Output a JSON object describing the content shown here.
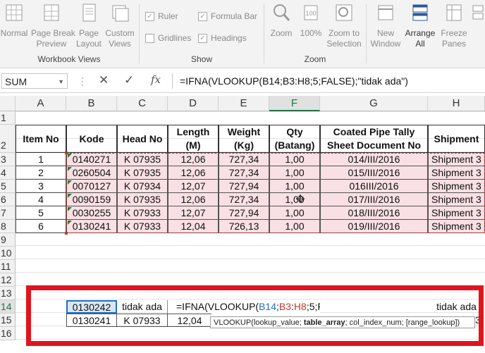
{
  "ribbon": {
    "workbook_views": {
      "label": "Workbook Views",
      "buttons": [
        {
          "label": "Normal",
          "icon": "normal-view-icon"
        },
        {
          "label": "Page Break\nPreview",
          "icon": "page-break-icon"
        },
        {
          "label": "Page\nLayout",
          "icon": "page-layout-icon"
        },
        {
          "label": "Custom\nViews",
          "icon": "custom-views-icon"
        }
      ]
    },
    "show": {
      "label": "Show",
      "ruler": "Ruler",
      "formula_bar": "Formula Bar",
      "gridlines": "Gridlines",
      "headings": "Headings"
    },
    "zoom": {
      "label": "Zoom",
      "zoom_btn": "Zoom",
      "hundred_btn": "100%",
      "selection_btn": "Zoom to\nSelection"
    },
    "window": {
      "new_window": "New\nWindow",
      "arrange_all": "Arrange\nAll",
      "freeze_panes": "Freeze\nPanes"
    }
  },
  "formula_bar": {
    "name_box": "SUM",
    "formula": "=IFNA(VLOOKUP(B14;B3:H8;5;FALSE);\"tidak ada\")",
    "cancel": "✕",
    "enter": "✓",
    "fx": "fx"
  },
  "columns": [
    "A",
    "B",
    "C",
    "D",
    "E",
    "F",
    "G",
    "H"
  ],
  "rows": [
    "1",
    "2",
    "3",
    "4",
    "5",
    "6",
    "7",
    "8",
    "9",
    "10",
    "11",
    "12",
    "13",
    "14",
    "15",
    "16"
  ],
  "headers": {
    "item_no": "Item No",
    "kode": "Kode",
    "head_no": "Head No",
    "length": "Length\n(M)",
    "weight": "Weight\n(Kg)",
    "qty": "Qty\n(Batang)",
    "tally": "Coated Pipe Tally\nSheet Document No",
    "shipment": "Shipment"
  },
  "table": [
    [
      "1",
      "0140271",
      "K 07935",
      "12,06",
      "727,34",
      "1,00",
      "014/III/2016",
      "Shipment 3"
    ],
    [
      "2",
      "0260504",
      "K 07935",
      "12,06",
      "727,34",
      "1,00",
      "015/III/2016",
      "Shipment 3"
    ],
    [
      "3",
      "0070127",
      "K 07934",
      "12,07",
      "727,94",
      "1,00",
      "016III/2016",
      "Shipment 3"
    ],
    [
      "4",
      "0090159",
      "K 07935",
      "12,06",
      "727,34",
      "1,00",
      "017/III/2016",
      "Shipment 3"
    ],
    [
      "5",
      "0030255",
      "K 07933",
      "12,07",
      "727,94",
      "1,00",
      "018/III/2016",
      "Shipment 3"
    ],
    [
      "6",
      "0130241",
      "K 07933",
      "12,04",
      "726,13",
      "1,00",
      "019/III/2016",
      "Shipment 3"
    ]
  ],
  "lookup_rows": {
    "row14": {
      "b": "0130242",
      "c": "tidak ada",
      "formula_prefix": "=IFNA(VLOOKUP(",
      "ref1": "B14",
      "sep1": ";",
      "ref2": "B3",
      "colon": ":",
      "ref3": "H8",
      "formula_suffix": ";5;FALSE);\"tidak ada\")",
      "h": "tidak ada"
    },
    "row15": {
      "b": "0130241",
      "c": "K 07933",
      "d": "12,04",
      "h": "3"
    }
  },
  "tooltip": {
    "fn": "VLOOKUP(",
    "arg1": "lookup_value; ",
    "arg2": "table_array",
    "rest": "; col_index_num; [range_lookup])"
  },
  "colors": {
    "ref_blue": "#1f6fc5",
    "ref_red": "#c0392b",
    "highlight_red": "#e0141f",
    "excel_green": "#217346",
    "pink_fill": "#f9e0e4"
  }
}
